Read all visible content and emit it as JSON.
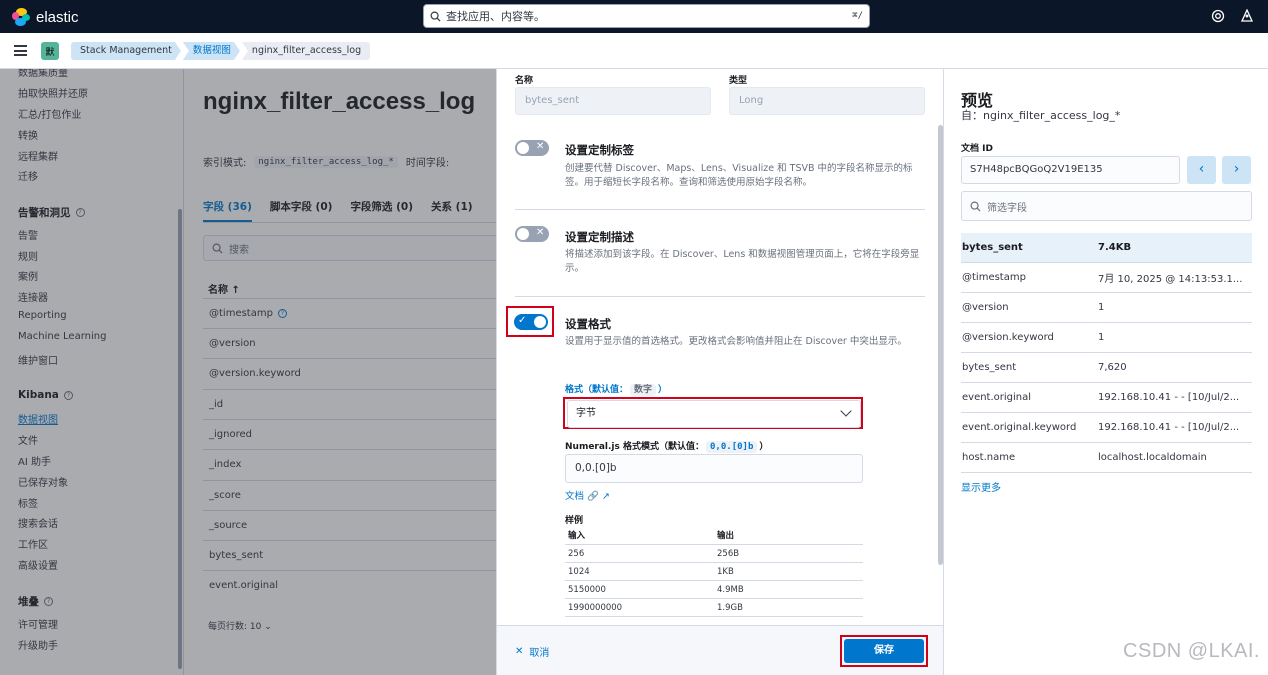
{
  "header": {
    "brand": "elastic",
    "search_placeholder": "查找应用、内容等。",
    "search_shortcut": "⌘/",
    "icons": [
      "help-icon",
      "user-menu-icon"
    ]
  },
  "breadcrumbs": {
    "space_initial": "默",
    "items": [
      "Stack Management",
      "数据视图",
      "nginx_filter_access_log"
    ]
  },
  "sidenav": {
    "items_top": [
      "数据集质量",
      "拍取快照并还原",
      "汇总/打包作业",
      "转换",
      "远程集群",
      "迁移"
    ],
    "alerts_section": "告警和洞见",
    "alerts_items": [
      "告警",
      "规则",
      "案例",
      "连接器",
      "Reporting",
      "Machine Learning",
      "维护窗口"
    ],
    "kibana_section": "Kibana",
    "kibana_items": [
      "数据视图",
      "文件",
      "AI 助手",
      "已保存对象",
      "标签",
      "搜索会话",
      "工作区",
      "高级设置"
    ],
    "stack_section": "堆叠",
    "stack_items": [
      "许可管理",
      "升级助手"
    ]
  },
  "main": {
    "title": "nginx_filter_access_log",
    "index_pattern_label": "索引模式:",
    "index_pattern": "nginx_filter_access_log_*",
    "time_field_label": "时间字段:",
    "tabs": [
      "字段 (36)",
      "脚本字段 (0)",
      "字段筛选 (0)",
      "关系 (1)"
    ],
    "search_placeholder": "搜索",
    "column_name": "名称 ↑",
    "fields": [
      "@timestamp",
      "@version",
      "@version.keyword",
      "_id",
      "_ignored",
      "_index",
      "_score",
      "_source",
      "bytes_sent",
      "event.original"
    ],
    "rows_per_page": "每页行数: 10"
  },
  "editor": {
    "name_label": "名称",
    "name_value": "bytes_sent",
    "type_label": "类型",
    "type_value": "Long",
    "custom_label_title": "设置定制标签",
    "custom_label_desc": "创建要代替 Discover、Maps、Lens、Visualize 和 TSVB 中的字段名称显示的标签。用于缩短长字段名称。查询和筛选使用原始字段名称。",
    "custom_desc_title": "设置定制描述",
    "custom_desc_desc": "将描述添加到该字段。在 Discover、Lens 和数据视图管理页面上，它将在字段旁显示。",
    "format_title": "设置格式",
    "format_desc": "设置用于显示值的首选格式。更改格式会影响值并阻止在 Discover 中突出显示。",
    "format_label": "格式（默认值：",
    "format_default": "数字",
    "format_label_end": "）",
    "format_value": "字节",
    "numeral_label": "Numeral.js 格式模式（默认值：",
    "numeral_default": "0,0.[0]b",
    "numeral_label_end": "）",
    "numeral_value": "0,0.[0]b",
    "doc_link": "文档",
    "samples_title": "样例",
    "samples_head": [
      "输入",
      "输出"
    ],
    "samples": [
      [
        "256",
        "256B"
      ],
      [
        "1024",
        "1KB"
      ],
      [
        "5150000",
        "4.9MB"
      ],
      [
        "1990000000",
        "1.9GB"
      ]
    ],
    "cancel_label": "取消",
    "save_label": "保存"
  },
  "preview": {
    "title": "预览",
    "subtitle": "自：nginx_filter_access_log_*",
    "doc_id_label": "文档 ID",
    "doc_id": "S7H48pcBQGoQ2V19E135",
    "filter_placeholder": "筛选字段",
    "rows": [
      {
        "k": "bytes_sent",
        "v": "7.4KB"
      },
      {
        "k": "@timestamp",
        "v": "7月 10, 2025 @ 14:13:53.1..."
      },
      {
        "k": "@version",
        "v": "1"
      },
      {
        "k": "@version.keyword",
        "v": "1"
      },
      {
        "k": "bytes_sent",
        "v": "7,620"
      },
      {
        "k": "event.original",
        "v": "192.168.10.41 - - [10/Jul/2..."
      },
      {
        "k": "event.original.keyword",
        "v": "192.168.10.41 - - [10/Jul/2..."
      },
      {
        "k": "host.name",
        "v": "localhost.localdomain"
      }
    ],
    "show_more": "显示更多"
  },
  "watermark": "CSDN @LKAI.",
  "colors": {
    "accent": "#0077cc",
    "header_bg": "#0b1628",
    "highlight": "#d0021b"
  }
}
